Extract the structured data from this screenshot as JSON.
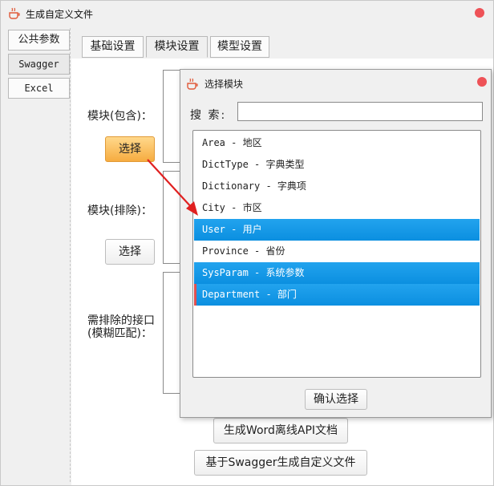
{
  "window": {
    "title": "生成自定义文件"
  },
  "left_nav": {
    "items": [
      {
        "label": "公共参数"
      },
      {
        "label": "Swagger"
      },
      {
        "label": "Excel"
      }
    ]
  },
  "tabs": [
    {
      "label": "基础设置"
    },
    {
      "label": "模块设置"
    },
    {
      "label": "模型设置"
    }
  ],
  "module_settings": {
    "include_label": "模块(包含)：",
    "include_select_button": "选择",
    "exclude_label": "模块(排除)：",
    "exclude_select_button": "选择",
    "exclude_api_label_line1": "需排除的接口",
    "exclude_api_label_line2": "(模糊匹配)："
  },
  "actions": {
    "generate_word_button": "生成Word离线API文档",
    "generate_custom_button": "基于Swagger生成自定义文件"
  },
  "dialog": {
    "title": "选择模块",
    "search_label": "搜 索:",
    "search_value": "",
    "items": [
      {
        "label": "Area - 地区",
        "selected": false
      },
      {
        "label": "DictType - 字典类型",
        "selected": false
      },
      {
        "label": "Dictionary - 字典项",
        "selected": false
      },
      {
        "label": "City - 市区",
        "selected": false
      },
      {
        "label": "User - 用户",
        "selected": true
      },
      {
        "label": "Province - 省份",
        "selected": false
      },
      {
        "label": "SysParam - 系统参数",
        "selected": true
      },
      {
        "label": "Department - 部门",
        "selected": true
      }
    ],
    "confirm_button": "确认选择"
  },
  "colors": {
    "accent_selected": "#0b8fe0",
    "close_button": "#ee5257",
    "highlight_button": "#f6ac40",
    "arrow": "#e02020"
  }
}
